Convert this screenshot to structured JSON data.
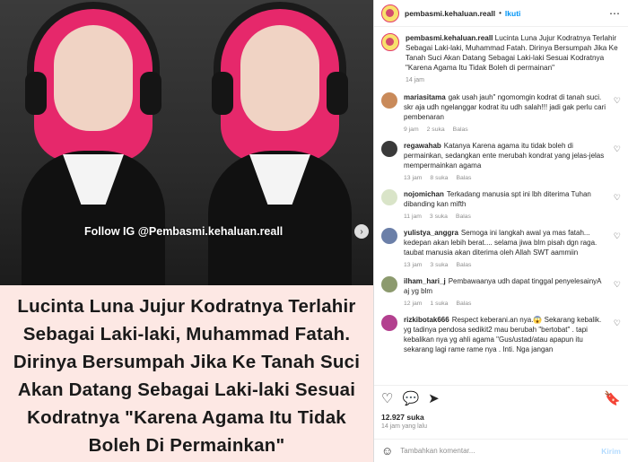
{
  "media": {
    "watermark": "Follow IG @Pembasmi.kehaluan.reall",
    "headline": "Lucinta Luna Jujur Kodratnya Terlahir Sebagai Laki-laki, Muhammad Fatah. Dirinya Bersumpah Jika Ke Tanah Suci Akan Datang Sebagai Laki-laki Sesuai Kodratnya \"Karena Agama Itu Tidak Boleh Di Permainkan\""
  },
  "header": {
    "username": "pembasmi.kehaluan.reall",
    "separator": "•",
    "follow_label": "Ikuti",
    "more_icon": "⋯"
  },
  "caption": {
    "username": "pembasmi.kehaluan.reall",
    "text": "Lucinta Luna Jujur Kodratnya Terlahir Sebagai Laki-laki, Muhammad Fatah. Dirinya Bersumpah Jika Ke Tanah Suci Akan Datang Sebagai Laki-laki Sesuai Kodratnya \"Karena Agama Itu Tidak Boleh di permainan\"",
    "time": "14 jam"
  },
  "comments": [
    {
      "user": "mariasitama",
      "text": "gak usah jauh\" ngomomgin kodrat di tanah suci. skr aja udh ngelanggar kodrat itu udh salah!!! jadi gak perlu cari pembenaran",
      "time": "9 jam",
      "likes": "2 suka",
      "reply": "Balas",
      "avatar_color": "#c98a5a"
    },
    {
      "user": "regawahab",
      "text": "Katanya Karena agama itu tidak boleh di permainkan, sedangkan ente merubah kondrat yang jelas-jelas mempermainkan agama",
      "time": "13 jam",
      "likes": "8 suka",
      "reply": "Balas",
      "avatar_color": "#3a3a3a"
    },
    {
      "user": "nojomichan",
      "text": "Terkadang manusia spt ini lbh diterima Tuhan dibanding kan mifth",
      "time": "11 jam",
      "likes": "3 suka",
      "reply": "Balas",
      "avatar_color": "#d9e4c8"
    },
    {
      "user": "yulistya_anggra",
      "text": "Semoga ini langkah awal ya mas fatah... kedepan akan lebih berat.... selama jiwa blm pisah dgn raga. taubat manusia akan diterima oleh Allah SWT aammiin",
      "time": "13 jam",
      "likes": "3 suka",
      "reply": "Balas",
      "avatar_color": "#6b7fa8"
    },
    {
      "user": "ilham_hari_j",
      "text": "Pembawaanya udh dapat tinggal penyelesainyA aj yg blm",
      "time": "12 jam",
      "likes": "1 suka",
      "reply": "Balas",
      "avatar_color": "#8c9a6e"
    },
    {
      "user": "rizkibotak666",
      "text": "Respect keberani.an nya.😱 Sekarang kebalik. yg tadinya pendosa sedikit2 mau berubah \"bertobat\" . tapi kebalikan nya yg ahli agama \"Gus/ustad/atau apapun itu sekarang lagi rame rame nya . Inti. Nga jangan",
      "time": "",
      "likes": "",
      "reply": "",
      "avatar_color": "#b3408f"
    }
  ],
  "actions": {
    "like_icon": "♡",
    "comment_icon": "💬",
    "share_icon": "➤",
    "save_icon": "🔖"
  },
  "likes": "12.927 suka",
  "ago": "14 jam yang lalu",
  "add_comment": {
    "emoji_icon": "☺",
    "placeholder": "Tambahkan komentar...",
    "post_label": "Kirim"
  }
}
